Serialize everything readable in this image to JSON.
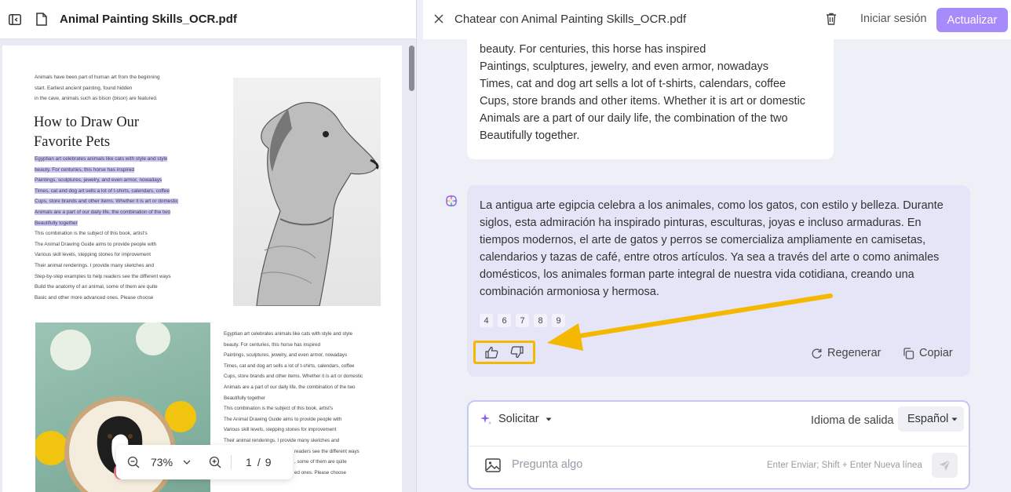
{
  "left_panel": {
    "file_title": "Animal Painting Skills_OCR.pdf",
    "pdf": {
      "intro_lines": [
        "Animals have been part of human art from the beginning",
        "start. Earliest ancient painting, found hidden",
        "in the cave, animals such as bison (bison) are featured."
      ],
      "heading_line1": "How to Draw Our",
      "heading_line2": "Favorite Pets",
      "highlighted_lines": [
        "Egyptian art celebrates animals like cats with style and style",
        "beauty. For centuries, this horse has inspired",
        "Paintings, sculptures, jewelry, and even armor, nowadays",
        "Times, cat and dog art sells a lot of t-shirts, calendars, coffee",
        "Cups, store brands and other items. Whether it is art or domestic",
        "Animals are a part of our daily life, the combination of the two",
        "Beautifully together"
      ],
      "body_lines": [
        "This combination is the subject of this book, artist's",
        "The Animal Drawing Guide aims to provide people with",
        "Various skill levels, stepping stones for improvement",
        "Their animal renderings. I provide many sketches and",
        "Step-by-step examples to help readers see the different ways",
        "Build the anatomy of an animal, some of them are quite",
        "Basic and other more advanced ones. Please choose"
      ],
      "col2_lines": [
        "Egyptian art celebrates animals like cats with style and style",
        "beauty. For centuries, this horse has inspired",
        "Paintings, sculptures, jewelry, and even armor, nowadays",
        "Times, cat and dog art sells a lot of t-shirts, calendars, coffee",
        "Cups, store brands and other items. Whether it is art or domestic",
        "Animals are a part of our daily life, the combination of the two",
        "Beautifully together",
        "This combination is the subject of this book, artist's",
        "The Animal Drawing Guide aims to provide people with",
        "Various skill levels, stepping stones for improvement",
        "Their animal renderings. I provide many sketches and",
        "readers see the different ways",
        ", some of them are quite",
        "ed ones. Please choose"
      ]
    },
    "zoom": {
      "value": "73%",
      "page_current": "1",
      "page_sep": "/",
      "page_total": "9"
    }
  },
  "right_panel": {
    "chat_title": "Chatear con Animal Painting Skills_OCR.pdf",
    "signin_label": "Iniciar sesión",
    "upgrade_label": "Actualizar",
    "user_message_lines": [
      "beauty. For centuries, this horse has inspired",
      "Paintings, sculptures, jewelry, and even armor, nowadays",
      "Times, cat and dog art sells a lot of t-shirts, calendars, coffee",
      "Cups, store brands and other items. Whether it is art or domestic",
      "Animals are a part of our daily life, the combination of the two",
      "Beautifully together."
    ],
    "ai_message": "La antigua arte egipcia celebra a los animales, como los gatos, con estilo y belleza. Durante siglos, esta admiración ha inspirado pinturas, esculturas, joyas e incluso armaduras. En tiempos modernos, el arte de gatos y perros se comercializa ampliamente en camisetas, calendarios y tazas de café, entre otros artículos. Ya sea a través del arte o como animales domésticos, los animales forman parte integral de nuestra vida cotidiana, creando una combinación armoniosa y hermosa.",
    "page_refs": [
      "4",
      "6",
      "7",
      "8",
      "9"
    ],
    "regenerate_label": "Regenerar",
    "copy_label": "Copiar",
    "composer": {
      "prompt_label": "Solicitar",
      "output_lang_label": "Idioma de salida",
      "output_lang_value": "Español",
      "placeholder": "Pregunta algo",
      "hint": "Enter Enviar; Shift + Enter Nueva línea"
    },
    "colors": {
      "accent": "#a78bfa",
      "highlight_box": "#f5b800",
      "ai_bubble": "#e6e5f8"
    }
  }
}
